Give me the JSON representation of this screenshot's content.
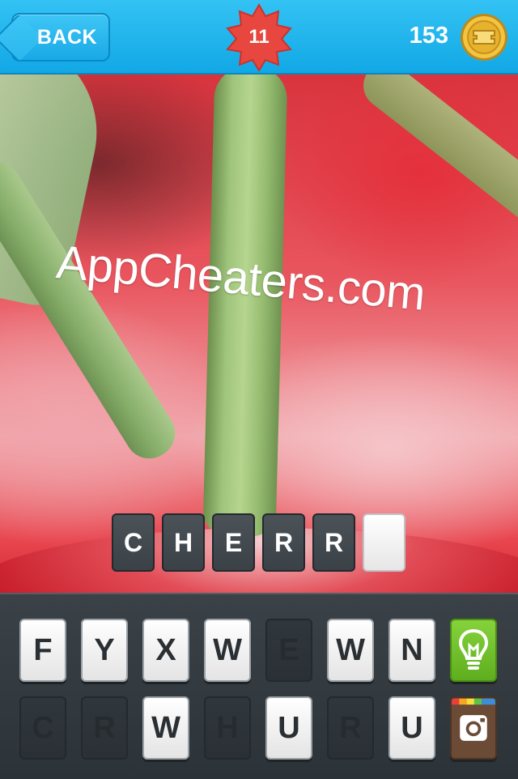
{
  "header": {
    "back_label": "BACK",
    "level": "11",
    "coins": "153"
  },
  "photo": {
    "watermark": "AppCheaters.com"
  },
  "answer": {
    "slots": [
      "C",
      "H",
      "E",
      "R",
      "R",
      ""
    ]
  },
  "keyboard": {
    "row1": [
      {
        "letter": "F",
        "state": "active"
      },
      {
        "letter": "Y",
        "state": "active"
      },
      {
        "letter": "X",
        "state": "active"
      },
      {
        "letter": "W",
        "state": "active"
      },
      {
        "letter": "E",
        "state": "used"
      },
      {
        "letter": "W",
        "state": "active"
      },
      {
        "letter": "N",
        "state": "active"
      }
    ],
    "row2": [
      {
        "letter": "C",
        "state": "used"
      },
      {
        "letter": "R",
        "state": "used"
      },
      {
        "letter": "W",
        "state": "active"
      },
      {
        "letter": "H",
        "state": "used"
      },
      {
        "letter": "U",
        "state": "active"
      },
      {
        "letter": "R",
        "state": "used"
      },
      {
        "letter": "U",
        "state": "active"
      }
    ],
    "hint_icon": "lightbulb-icon",
    "share_icon": "instagram-icon"
  },
  "colors": {
    "topbar": "#1fb0ea",
    "badge": "#e8473f",
    "hint": "#6cbf27"
  }
}
